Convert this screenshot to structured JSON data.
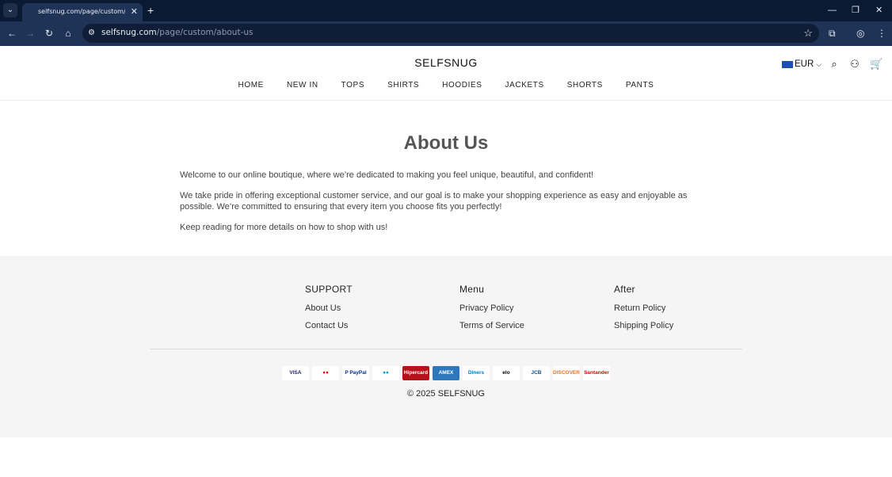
{
  "browser": {
    "tab_title": "selfsnug.com/page/custom/ab",
    "url_domain": "selfsnug.com",
    "url_path": "/page/custom/about-us",
    "icons": [
      "tab-search-icon",
      "close-icon",
      "plus-icon",
      "minimize-icon",
      "restore-icon",
      "close-window-icon",
      "back-icon",
      "forward-icon",
      "reload-icon",
      "home-icon",
      "site-info-icon",
      "star-icon",
      "extensions-icon",
      "profile-icon",
      "menu-icon"
    ]
  },
  "header": {
    "logo": "SELFSNUG",
    "currency": "EUR",
    "nav": [
      "HOME",
      "NEW IN",
      "TOPS",
      "SHIRTS",
      "HOODIES",
      "JACKETS",
      "SHORTS",
      "PANTS"
    ]
  },
  "main": {
    "title": "About Us",
    "paragraphs": [
      "Welcome to our online boutique, where we’re dedicated to making you feel unique, beautiful, and confident!",
      "We take pride in offering exceptional customer service, and our goal is to make your shopping experience as easy and enjoyable as possible. We’re committed to ensuring that every item you choose fits you perfectly!",
      "Keep reading for more details on how to shop with us!"
    ]
  },
  "footer": {
    "columns": [
      {
        "title": "SUPPORT",
        "links": [
          "About Us",
          "Contact Us"
        ]
      },
      {
        "title": "Menu",
        "links": [
          "Privacy Policy",
          "Terms of Service"
        ]
      },
      {
        "title": "After",
        "links": [
          "Return Policy",
          "Shipping Policy"
        ]
      }
    ],
    "payments": [
      {
        "name": "VISA",
        "color": "#1a1f71",
        "bg": "#ffffff"
      },
      {
        "name": "●●",
        "color": "#eb001b",
        "bg": "#ffffff"
      },
      {
        "name": "P PayPal",
        "color": "#003087",
        "bg": "#ffffff"
      },
      {
        "name": "●●",
        "color": "#0099df",
        "bg": "#ffffff"
      },
      {
        "name": "Hipercard",
        "color": "#ffffff",
        "bg": "#b3131b"
      },
      {
        "name": "AMEX",
        "color": "#ffffff",
        "bg": "#2e77bb"
      },
      {
        "name": "Diners",
        "color": "#0079be",
        "bg": "#ffffff"
      },
      {
        "name": "elo",
        "color": "#000000",
        "bg": "#ffffff"
      },
      {
        "name": "JCB",
        "color": "#0e4c96",
        "bg": "#ffffff"
      },
      {
        "name": "DISCOVER",
        "color": "#f76f20",
        "bg": "#ffffff"
      },
      {
        "name": "Santander",
        "color": "#ec0000",
        "bg": "#ffffff"
      }
    ],
    "copyright": "© 2025 SELFSNUG"
  }
}
